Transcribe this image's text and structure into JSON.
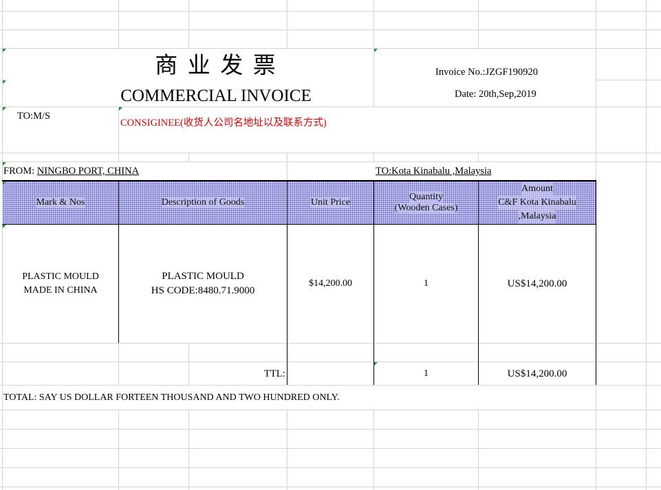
{
  "invoice": {
    "title_cn": "商 业 发 票",
    "title_en": "COMMERCIAL INVOICE",
    "invoice_no": "Invoice No.:JZGF190920",
    "date": "Date: 20th,Sep,2019",
    "to_label": "TO:M/S",
    "consignee": "CONSIGINEE(收货人公司名地址以及联系方式)",
    "from_label": "FROM:",
    "from_value": "NINGBO PORT, CHINA",
    "to_port": "TO:Kota Kinabalu ,Malaysia",
    "columns": [
      {
        "line1": "Mark & Nos"
      },
      {
        "line1": "Description of Goods"
      },
      {
        "line1": "Unit Price"
      },
      {
        "line1": "Quantity",
        "line2": "(Wooden Cases)"
      },
      {
        "line1": "Amount",
        "line2": "C&F Kota Kinabalu",
        "line3": ",Malaysia"
      }
    ],
    "row": {
      "mark_line1": "PLASTIC MOULD",
      "mark_line2": "MADE IN CHINA",
      "desc_line1": "PLASTIC MOULD",
      "desc_line2": "HS CODE:8480.71.9000",
      "unit_price": "$14,200.00",
      "quantity": "1",
      "amount": "US$14,200.00"
    },
    "ttl_label": "TTL:",
    "ttl_quantity": "1",
    "ttl_amount": "US$14,200.00",
    "total_words": "TOTAL: SAY US DOLLAR FORTEEN  THOUSAND AND TWO HUNDRED  ONLY."
  },
  "colors": {
    "gridline": "#d4d4d4",
    "header_fill": "#c8c8f0",
    "consignee_text": "#e00000",
    "comment_marker": "#1c8a2e"
  }
}
